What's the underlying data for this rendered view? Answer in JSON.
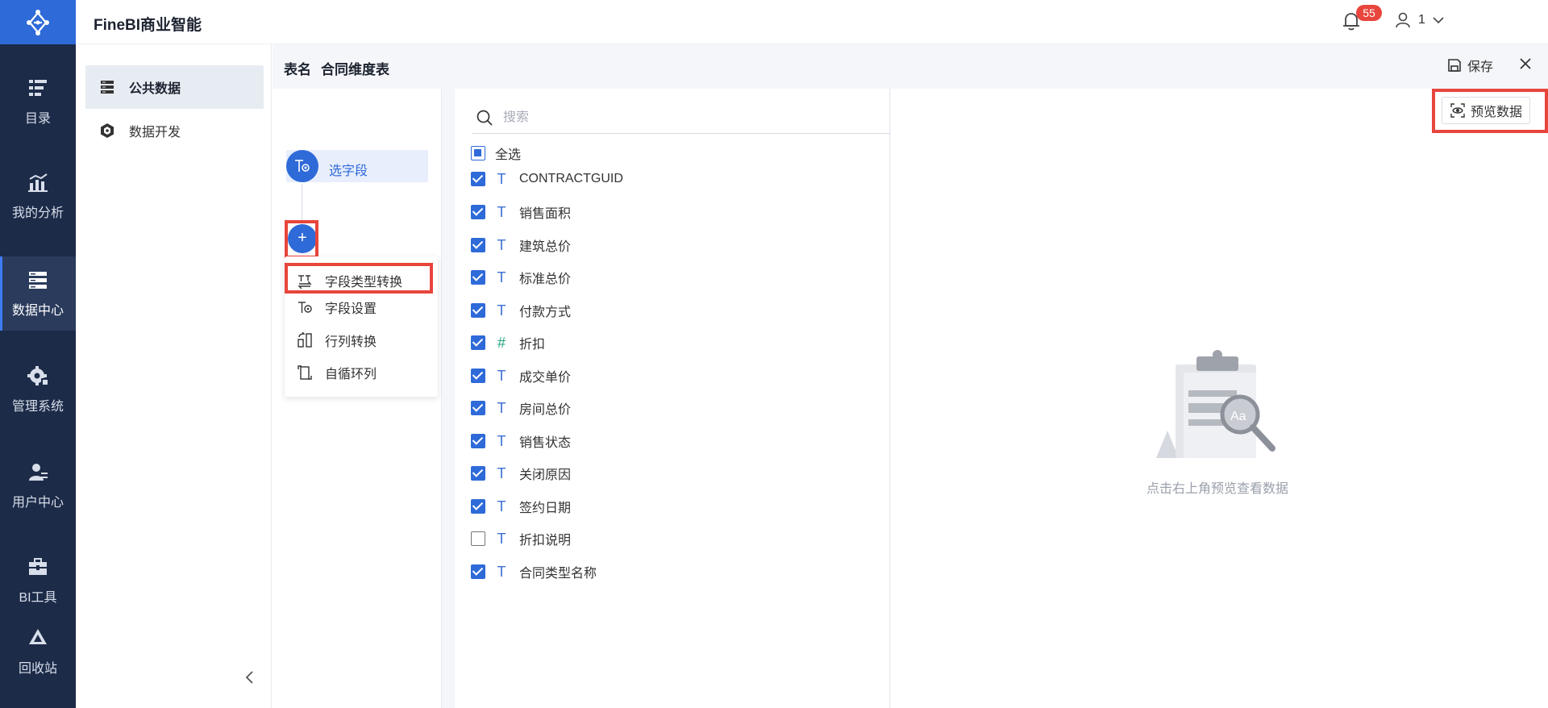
{
  "app": {
    "title": "FineBI商业智能"
  },
  "header": {
    "notification_count": "55",
    "user_name": "1"
  },
  "rail": {
    "items": [
      {
        "label": "目录",
        "icon": "catalog-icon"
      },
      {
        "label": "我的分析",
        "icon": "analysis-icon"
      },
      {
        "label": "数据中心",
        "icon": "data-center-icon",
        "active": true
      },
      {
        "label": "管理系统",
        "icon": "settings-gear-icon"
      },
      {
        "label": "用户中心",
        "icon": "user-center-icon"
      },
      {
        "label": "BI工具",
        "icon": "toolbox-icon"
      },
      {
        "label": "回收站",
        "icon": "recycle-bin-icon"
      }
    ]
  },
  "subnav": {
    "items": [
      {
        "label": "公共数据",
        "icon": "table-icon",
        "active": true
      },
      {
        "label": "数据开发",
        "icon": "cube-icon"
      }
    ]
  },
  "editor": {
    "table_name_label": "表名",
    "table_name": "合同维度表",
    "save_label": "保存",
    "step_label": "选字段",
    "add_label": "+",
    "menu": [
      {
        "label": "字段类型转换",
        "icon": "type-convert-icon"
      },
      {
        "label": "字段设置",
        "icon": "field-settings-icon"
      },
      {
        "label": "行列转换",
        "icon": "row-column-convert-icon"
      },
      {
        "label": "自循环列",
        "icon": "self-loop-column-icon"
      }
    ]
  },
  "fields": {
    "search_placeholder": "搜索",
    "select_all_label": "全选",
    "items": [
      {
        "name": "CONTRACTGUID",
        "type": "text",
        "checked": true
      },
      {
        "name": "销售面积",
        "type": "text",
        "checked": true
      },
      {
        "name": "建筑总价",
        "type": "text",
        "checked": true
      },
      {
        "name": "标准总价",
        "type": "text",
        "checked": true
      },
      {
        "name": "付款方式",
        "type": "text",
        "checked": true
      },
      {
        "name": "折扣",
        "type": "number",
        "checked": true
      },
      {
        "name": "成交单价",
        "type": "text",
        "checked": true
      },
      {
        "name": "房间总价",
        "type": "text",
        "checked": true
      },
      {
        "name": "销售状态",
        "type": "text",
        "checked": true
      },
      {
        "name": "关闭原因",
        "type": "text",
        "checked": true
      },
      {
        "name": "签约日期",
        "type": "text",
        "checked": true
      },
      {
        "name": "折扣说明",
        "type": "text",
        "checked": false
      },
      {
        "name": "合同类型名称",
        "type": "text",
        "checked": true
      }
    ]
  },
  "preview": {
    "button_label": "预览数据",
    "empty_text": "点击右上角预览查看数据"
  },
  "colors": {
    "accent": "#2e6ad8",
    "rail_bg": "#1c2b48",
    "highlight": "#e8453c"
  }
}
